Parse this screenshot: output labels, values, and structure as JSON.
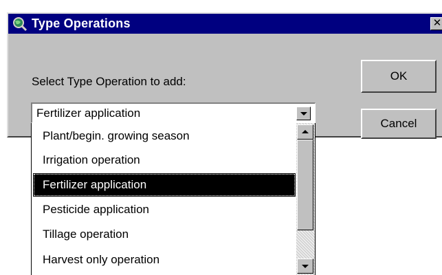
{
  "window": {
    "title": "Type Operations",
    "close_glyph": "✕",
    "icon": "magnifier-globe-icon"
  },
  "prompt": "Select Type Operation to add:",
  "buttons": {
    "ok_label": "OK",
    "cancel_label": "Cancel"
  },
  "combo": {
    "selected_value": "Fertilizer application"
  },
  "list": {
    "items": [
      "Plant/begin. growing season",
      "Irrigation operation",
      "Fertilizer application",
      "Pesticide application",
      "Tillage operation",
      "Harvest only operation"
    ],
    "selected_index": 2
  },
  "colors": {
    "titlebar": "#000080",
    "dialog_face": "#c0c0c0",
    "selection": "#000000"
  }
}
